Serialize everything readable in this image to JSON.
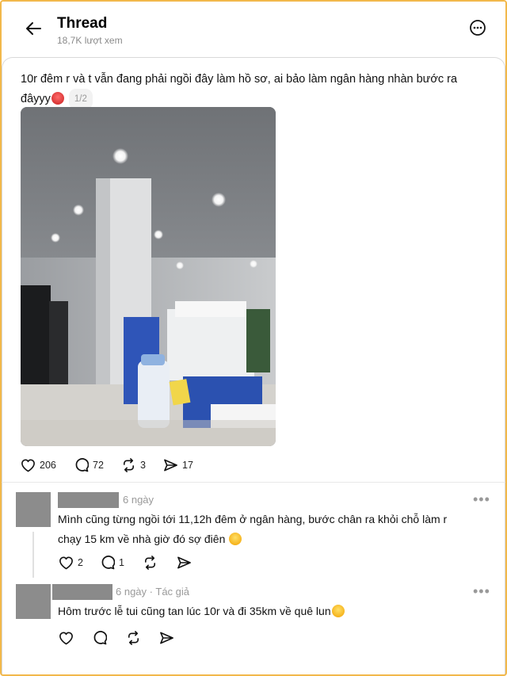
{
  "header": {
    "title": "Thread",
    "subtitle": "18,7K lượt xem"
  },
  "post": {
    "text": "10r đêm r và t vẫn đang phải ngồi đây làm hồ sơ, ai bảo làm ngân hàng nhàn bước ra đâyyy",
    "page_indicator": "1/2",
    "image_alt": "office desk with stacks of files at night",
    "stats": {
      "likes": "206",
      "comments": "72",
      "reposts": "3",
      "shares": "17"
    }
  },
  "comments": [
    {
      "time": "6 ngày",
      "text_line1": "Mình cũng từng ngồi tới 11,12h đêm ở ngân hàng, bước chân ra khỏi chỗ làm r",
      "text_line2": "chạy 15 km về nhà giờ đó sợ điên",
      "likes": "2",
      "replies": "1",
      "more": "•••"
    },
    {
      "time": "6 ngày",
      "author_tag": "· Tác giả",
      "text": "Hôm trước lễ tui cũng tan lúc 10r và đi 35km về quê lun",
      "more": "•••"
    }
  ]
}
